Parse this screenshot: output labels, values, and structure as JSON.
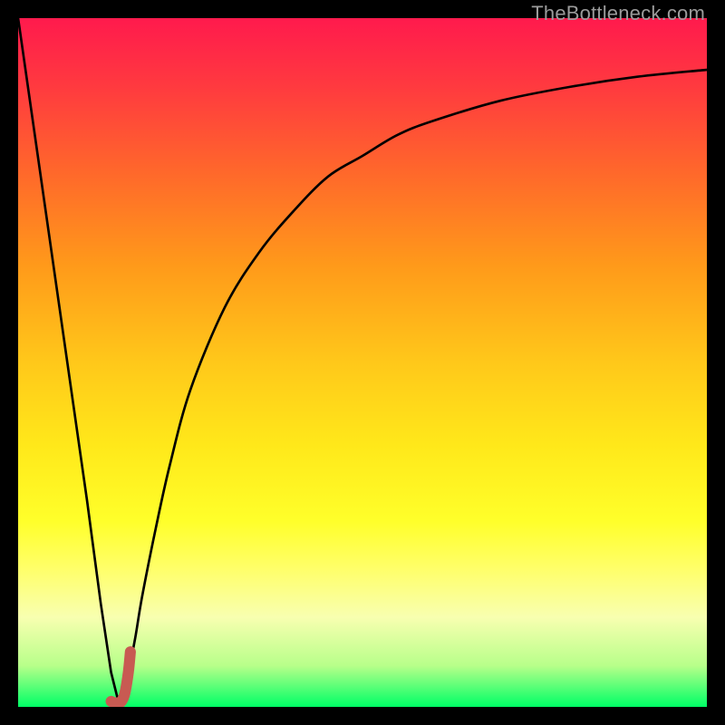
{
  "attribution": "TheBottleneck.com",
  "colors": {
    "frame": "#000000",
    "attribution": "#9b9b9b",
    "gradient_stops": [
      {
        "pos": 0.0,
        "hex": "#ff1a4d"
      },
      {
        "pos": 0.1,
        "hex": "#ff3a3f"
      },
      {
        "pos": 0.23,
        "hex": "#ff6a2a"
      },
      {
        "pos": 0.36,
        "hex": "#ff9a1a"
      },
      {
        "pos": 0.5,
        "hex": "#ffc81a"
      },
      {
        "pos": 0.62,
        "hex": "#ffe81a"
      },
      {
        "pos": 0.73,
        "hex": "#ffff2a"
      },
      {
        "pos": 0.8,
        "hex": "#ffff6a"
      },
      {
        "pos": 0.87,
        "hex": "#f8ffb0"
      },
      {
        "pos": 0.94,
        "hex": "#b8ff8a"
      },
      {
        "pos": 1.0,
        "hex": "#00ff66"
      }
    ],
    "curve": "#000000",
    "marker": "#c85a52"
  },
  "chart_data": {
    "type": "line",
    "title": "",
    "xlabel": "",
    "ylabel": "",
    "xlim": [
      0,
      100
    ],
    "ylim": [
      0,
      100
    ],
    "note": "Rainbow-gradient bottleneck chart. Vertical color bands encode bottleneck severity (red=high, green=ideal). Two black curves: a steep descending line and a rising saturating curve that intersect near x≈14% (the sweet spot). A short pink marker highlights the optimum.",
    "series": [
      {
        "name": "descending-curve",
        "x": [
          0,
          2,
          4,
          6,
          8,
          10,
          12,
          13.5,
          14.5
        ],
        "y": [
          100,
          86,
          72,
          58,
          44,
          30,
          15,
          5,
          1
        ]
      },
      {
        "name": "ascending-curve",
        "x": [
          15,
          16,
          17,
          18,
          20,
          22,
          25,
          30,
          35,
          40,
          45,
          50,
          55,
          60,
          70,
          80,
          90,
          100
        ],
        "y": [
          1,
          5,
          10,
          16,
          26,
          35,
          46,
          58,
          66,
          72,
          77,
          80,
          83,
          85,
          88,
          90,
          91.5,
          92.5
        ]
      },
      {
        "name": "optimum-marker",
        "x": [
          13.5,
          14.0,
          14.5,
          15.0,
          15.5,
          16.0,
          16.3
        ],
        "y": [
          0.8,
          0.6,
          0.6,
          0.8,
          2.0,
          5.0,
          8.0
        ]
      }
    ]
  }
}
